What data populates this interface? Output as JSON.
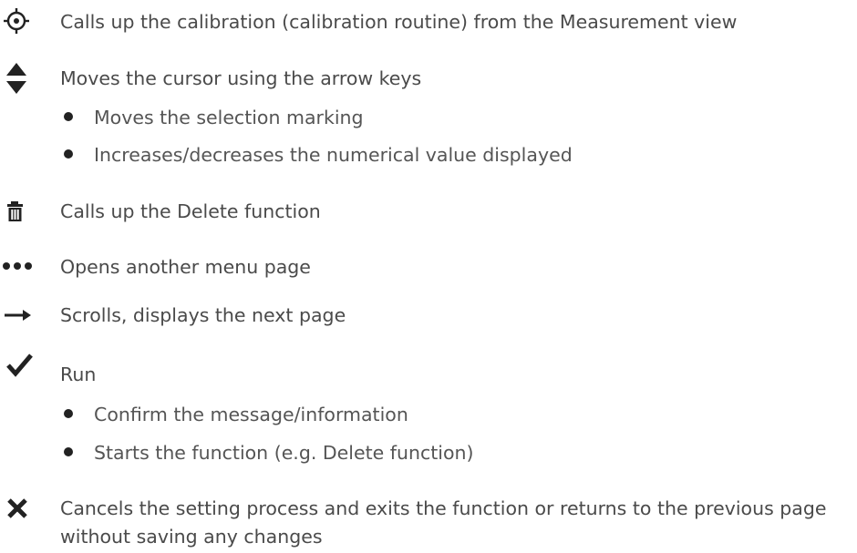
{
  "items": [
    {
      "icon": "calibration-target-icon",
      "text": "Calls up the calibration (calibration routine) from the Measurement view"
    },
    {
      "icon": "up-down-arrows-icon",
      "text": "Moves the cursor using the arrow keys",
      "bullets": [
        "Moves the selection marking",
        "Increases/decreases the numerical value displayed"
      ]
    },
    {
      "icon": "trash-icon",
      "text": "Calls up the Delete function"
    },
    {
      "icon": "more-dots-icon",
      "text": "Opens another menu page"
    },
    {
      "icon": "arrow-right-icon",
      "text": "Scrolls, displays the next page"
    },
    {
      "icon": "checkmark-icon",
      "text": "Run",
      "bullets": [
        "Confirm the message/information",
        "Starts the function (e.g. Delete function)"
      ]
    },
    {
      "icon": "close-x-icon",
      "text": "Cancels the setting process and exits the function or returns to the previous page without saving any changes"
    }
  ]
}
